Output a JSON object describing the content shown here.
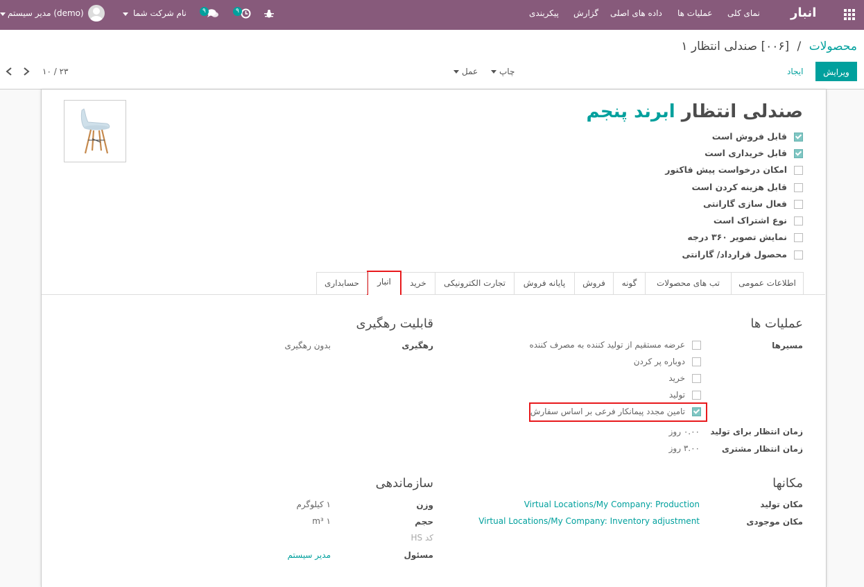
{
  "nav": {
    "app_name": "انبار",
    "menu": [
      "نمای کلی",
      "عملیات ها",
      "داده های اصلی",
      "گزارش",
      "پیکربندی"
    ],
    "user": "مدیر سیستم (demo)",
    "company": "نام شرکت شما",
    "messages_badge": "۹",
    "activity_badge": "۹"
  },
  "breadcrumb": {
    "parent": "محصولات",
    "separator": "/",
    "current": "[۰۰۶] صندلی انتظار ۱"
  },
  "toolbar": {
    "edit": "ویرایش",
    "create": "ایجاد",
    "print": "چاپ",
    "action": "عمل",
    "pager": "۱۰ / ۲۳"
  },
  "product": {
    "title_main": "صندلی انتظار ",
    "title_highlight": "ابرند پنجم",
    "flags": [
      {
        "label": "قابل فروش است",
        "checked": true
      },
      {
        "label": "قابل خریداری است",
        "checked": true
      },
      {
        "label": "امکان درخواست پیش فاکتور",
        "checked": false
      },
      {
        "label": "قابل هزینه کردن است",
        "checked": false
      },
      {
        "label": "فعال سازی گارانتی",
        "checked": false
      },
      {
        "label": "نوع اشتراک است",
        "checked": false
      },
      {
        "label": "نمایش تصویر ۳۶۰ درجه",
        "checked": false
      },
      {
        "label": "محصول قرارداد/ گارانتی",
        "checked": false
      }
    ]
  },
  "tabs": [
    "اطلاعات عمومی",
    "تب های محصولات",
    "گونه",
    "فروش",
    "پایانه فروش",
    "تجارت الکترونیکی",
    "خرید",
    "انبار",
    "حسابداری"
  ],
  "operations": {
    "heading": "عملیات ها",
    "routes_label": "مسیرها",
    "routes": [
      {
        "label": "عرضه مستقیم از تولید کننده به مصرف کننده",
        "checked": false
      },
      {
        "label": "دوباره پر کردن",
        "checked": false
      },
      {
        "label": "خرید",
        "checked": false
      },
      {
        "label": "تولید",
        "checked": false
      },
      {
        "label": "تامین مجدد پیمانکار فرعی بر اساس سفارش",
        "checked": true
      }
    ],
    "mfg_lead_label": "زمان انتظار برای تولید",
    "mfg_lead_value": "۰.۰۰ روز",
    "cust_lead_label": "زمان انتظار مشتری",
    "cust_lead_value": "۳.۰۰ روز"
  },
  "traceability": {
    "heading": "قابلیت رهگیری",
    "label": "رهگیری",
    "value": "بدون رهگیری"
  },
  "locations": {
    "heading": "مکانها",
    "production_label": "مکان تولید",
    "production_value": "Virtual Locations/My Company: Production",
    "inventory_label": "مکان موجودی",
    "inventory_value": "Virtual Locations/My Company: Inventory adjustment"
  },
  "logistics": {
    "heading": "سازماندهی",
    "weight_label": "وزن",
    "weight_value": "۱ کیلوگرم",
    "volume_label": "حجم",
    "volume_value": "m³ ۱",
    "hs_label": "کد HS",
    "responsible_label": "مسئول",
    "responsible_value": "مدیر سیستم"
  },
  "colors": {
    "navbar": "#875a7b",
    "accent": "#00a09d",
    "highlight_box": "#e8191c"
  }
}
